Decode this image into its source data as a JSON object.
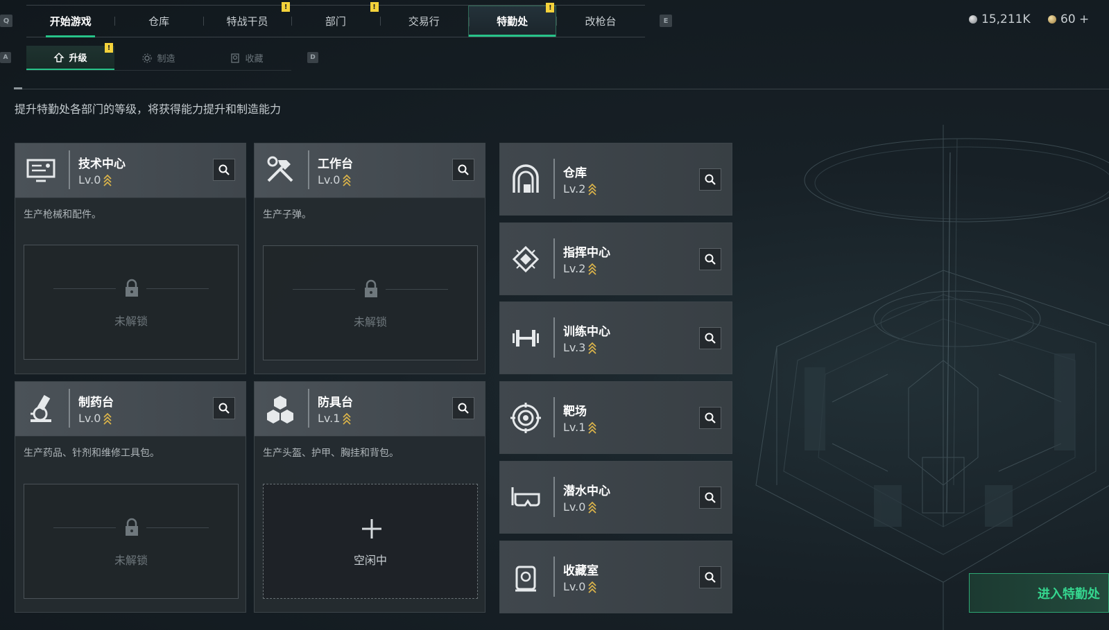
{
  "keys": {
    "left": "Q",
    "right": "E",
    "sub_left": "A",
    "sub_right": "D"
  },
  "top_tabs": [
    {
      "label": "开始游戏",
      "alert": false
    },
    {
      "label": "仓库",
      "alert": false
    },
    {
      "label": "特战干员",
      "alert": true
    },
    {
      "label": "部门",
      "alert": true
    },
    {
      "label": "交易行",
      "alert": false
    },
    {
      "label": "特勤处",
      "alert": true
    },
    {
      "label": "改枪台",
      "alert": false
    }
  ],
  "alert_mark": "!",
  "currency": {
    "silver": "15,211K",
    "gold": "60 +"
  },
  "sub_tabs": [
    {
      "label": "升级",
      "icon": "upgrade-icon"
    },
    {
      "label": "制造",
      "icon": "gear-icon"
    },
    {
      "label": "收藏",
      "icon": "trophy-icon"
    }
  ],
  "description": "提升特勤处各部门的等级，将获得能力提升和制造能力",
  "cards": [
    {
      "title": "技术中心",
      "level": "Lv.0",
      "desc": "生产枪械和配件。",
      "status": "未解锁"
    },
    {
      "title": "工作台",
      "level": "Lv.0",
      "desc": "生产子弹。",
      "status": "未解锁"
    },
    {
      "title": "制药台",
      "level": "Lv.0",
      "desc": "生产药品、针剂和维修工具包。",
      "status": "未解锁"
    },
    {
      "title": "防具台",
      "level": "Lv.1",
      "desc": "生产头盔、护甲、胸挂和背包。",
      "status": "空闲中"
    }
  ],
  "side_cards": [
    {
      "title": "仓库",
      "level": "Lv.2"
    },
    {
      "title": "指挥中心",
      "level": "Lv.2"
    },
    {
      "title": "训练中心",
      "level": "Lv.3"
    },
    {
      "title": "靶场",
      "level": "Lv.1"
    },
    {
      "title": "潜水中心",
      "level": "Lv.0"
    },
    {
      "title": "收藏室",
      "level": "Lv.0"
    }
  ],
  "enter_button": "进入特勤处",
  "colors": {
    "accent": "#27c389",
    "alert": "#f4d23b",
    "level_chevron": "#d9b34a"
  }
}
